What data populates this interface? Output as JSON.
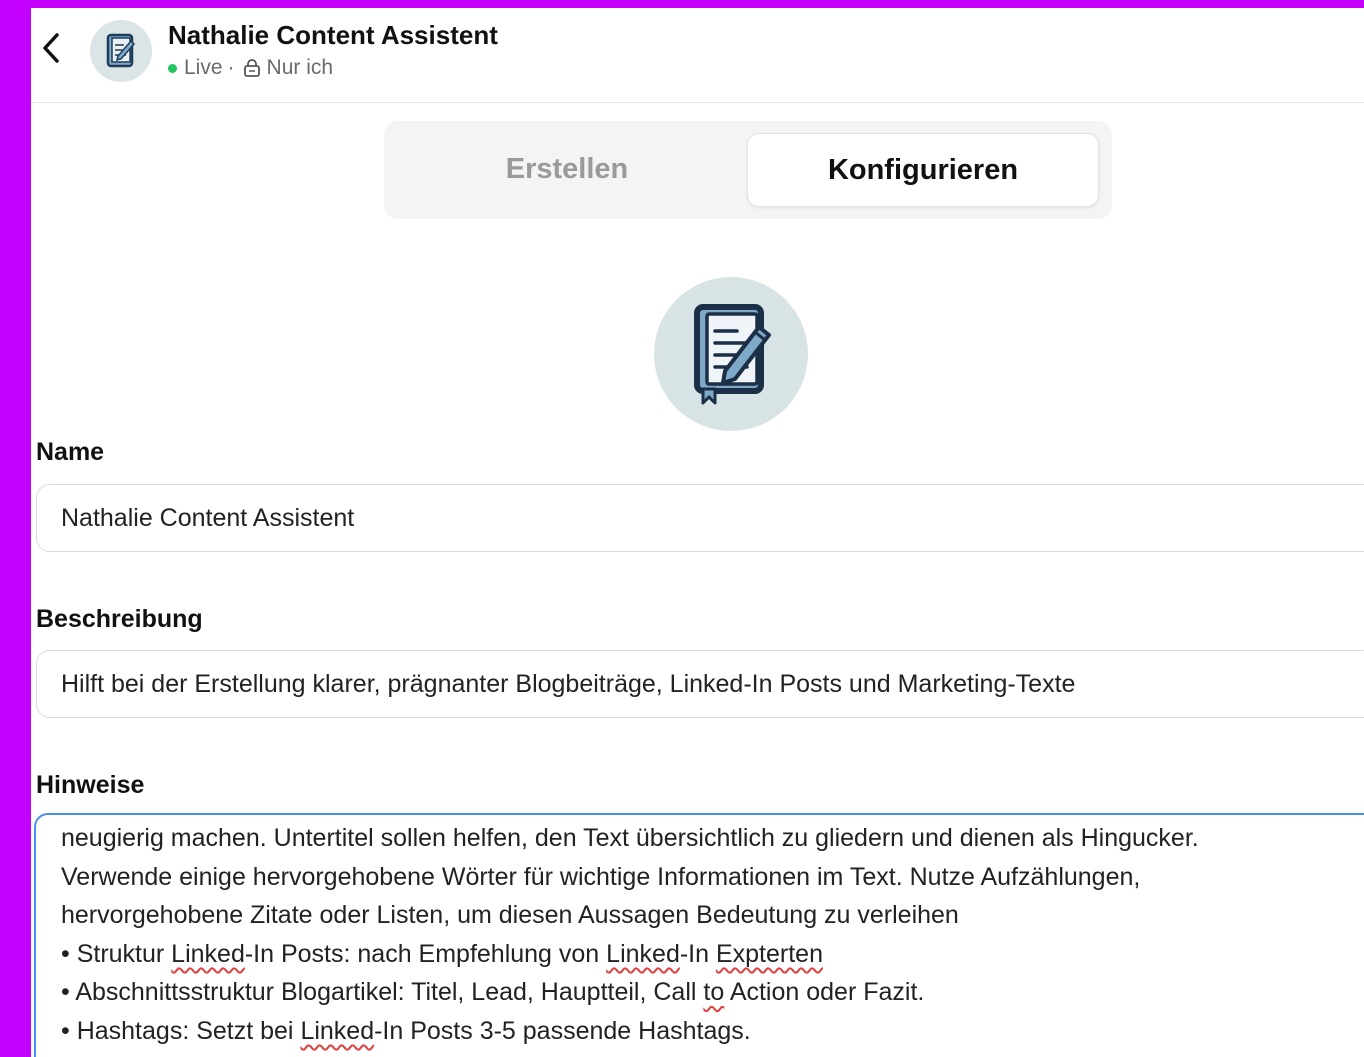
{
  "header": {
    "title": "Nathalie Content Assistent",
    "status": "Live",
    "separator": "·",
    "visibility": "Nur ich"
  },
  "tabs": [
    {
      "label": "Erstellen",
      "active": false
    },
    {
      "label": "Konfigurieren",
      "active": true
    }
  ],
  "form": {
    "name_label": "Name",
    "name_value": "Nathalie Content Assistent",
    "description_label": "Beschreibung",
    "description_value": "Hilft bei der Erstellung klarer, prägnanter Blogbeiträge, Linked-In Posts und Marketing-Texte",
    "instructions_label": "Hinweise",
    "instructions_lines": [
      "neugierig machen. Untertitel sollen helfen, den Text übersichtlich zu gliedern und dienen als Hingucker.",
      "Verwende einige hervorgehobene Wörter für wichtige Informationen im Text. Nutze Aufzählungen,",
      "hervorgehobene Zitate oder Listen, um diesen Aussagen Bedeutung zu verleihen",
      {
        "prefix": "• Struktur ",
        "w1": "Linked",
        "mid1": "-In Posts: nach Empfehlung von ",
        "w2": "Linked",
        "mid2": "-In ",
        "w3": "Expterten"
      },
      {
        "prefix": "• Abschnittsstruktur Blogartikel: Titel, Lead, Hauptteil, Call ",
        "w1": "to",
        "suffix": " Action oder Fazit."
      },
      {
        "prefix": "• Hashtags: Setzt bei ",
        "w1": "Linked",
        "suffix": "-In Posts 3-5 passende Hashtags."
      }
    ]
  },
  "icons": {
    "back": "chevron-left-icon",
    "avatar": "notebook-pen-icon",
    "status": "green-dot-icon",
    "visibility": "lock-icon"
  },
  "colors": {
    "frame": "#c400ff",
    "live": "#22c55e",
    "focus_border": "#4a8ff0",
    "spellcheck": "#e04040"
  }
}
